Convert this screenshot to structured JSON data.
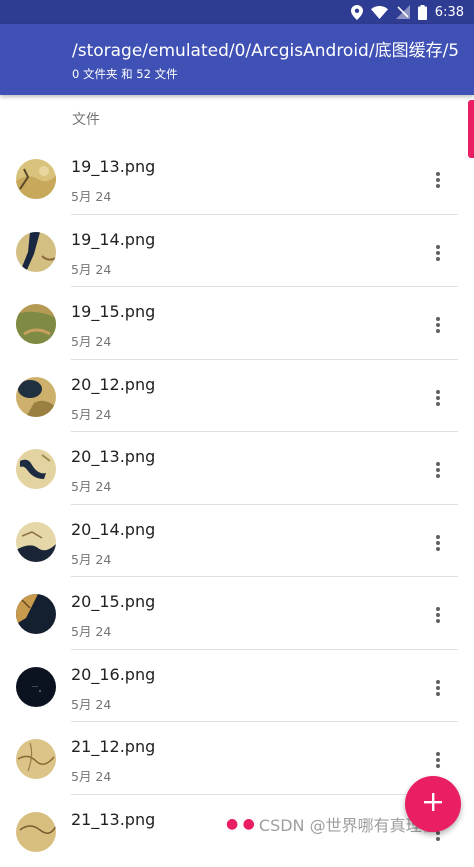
{
  "status_bar": {
    "time": "6:38",
    "icons": [
      "location-icon",
      "wifi-icon",
      "no-signal-icon",
      "battery-icon"
    ]
  },
  "app_bar": {
    "path": "/storage/emulated/0/ArcgisAndroid/底图缓存/5",
    "subtitle": "0 文件夹 和 52 文件"
  },
  "section_header": "文件",
  "files": [
    {
      "name": "19_13.png",
      "date": "5月 24"
    },
    {
      "name": "19_14.png",
      "date": "5月 24"
    },
    {
      "name": "19_15.png",
      "date": "5月 24"
    },
    {
      "name": "20_12.png",
      "date": "5月 24"
    },
    {
      "name": "20_13.png",
      "date": "5月 24"
    },
    {
      "name": "20_14.png",
      "date": "5月 24"
    },
    {
      "name": "20_15.png",
      "date": "5月 24"
    },
    {
      "name": "20_16.png",
      "date": "5月 24"
    },
    {
      "name": "21_12.png",
      "date": "5月 24"
    },
    {
      "name": "21_13.png",
      "date": ""
    }
  ],
  "fab": {
    "icon": "plus-icon"
  },
  "watermark": "CSDN @世界哪有真理在",
  "colors": {
    "primary": "#3f51b5",
    "primary_dark": "#2f3c93",
    "accent": "#e91e63"
  }
}
